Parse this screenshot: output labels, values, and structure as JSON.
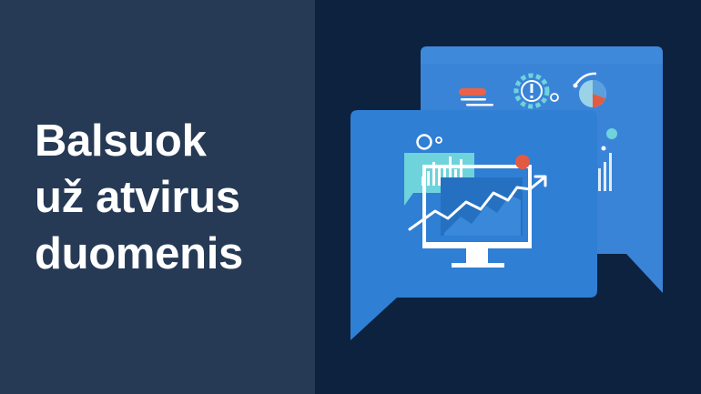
{
  "headline": {
    "lines": [
      "Balsuok",
      "už atvirus",
      "duomenis"
    ]
  },
  "icons": {
    "back_card": [
      "alert-banner-icon",
      "gear-alert-icon",
      "globe-pie-icon",
      "bar-stack-icon"
    ],
    "front_card": [
      "bubble-bar-chart-icon",
      "monitor-line-chart-icon",
      "trend-arrow-icon"
    ]
  },
  "colors": {
    "left_background": "#263a55",
    "right_background": "#0c223f",
    "card_back": "#3380d6",
    "card_front": "#2f7fd4",
    "accent_teal": "#6fd3dc",
    "accent_red": "#e35a41",
    "text": "#ffffff"
  }
}
